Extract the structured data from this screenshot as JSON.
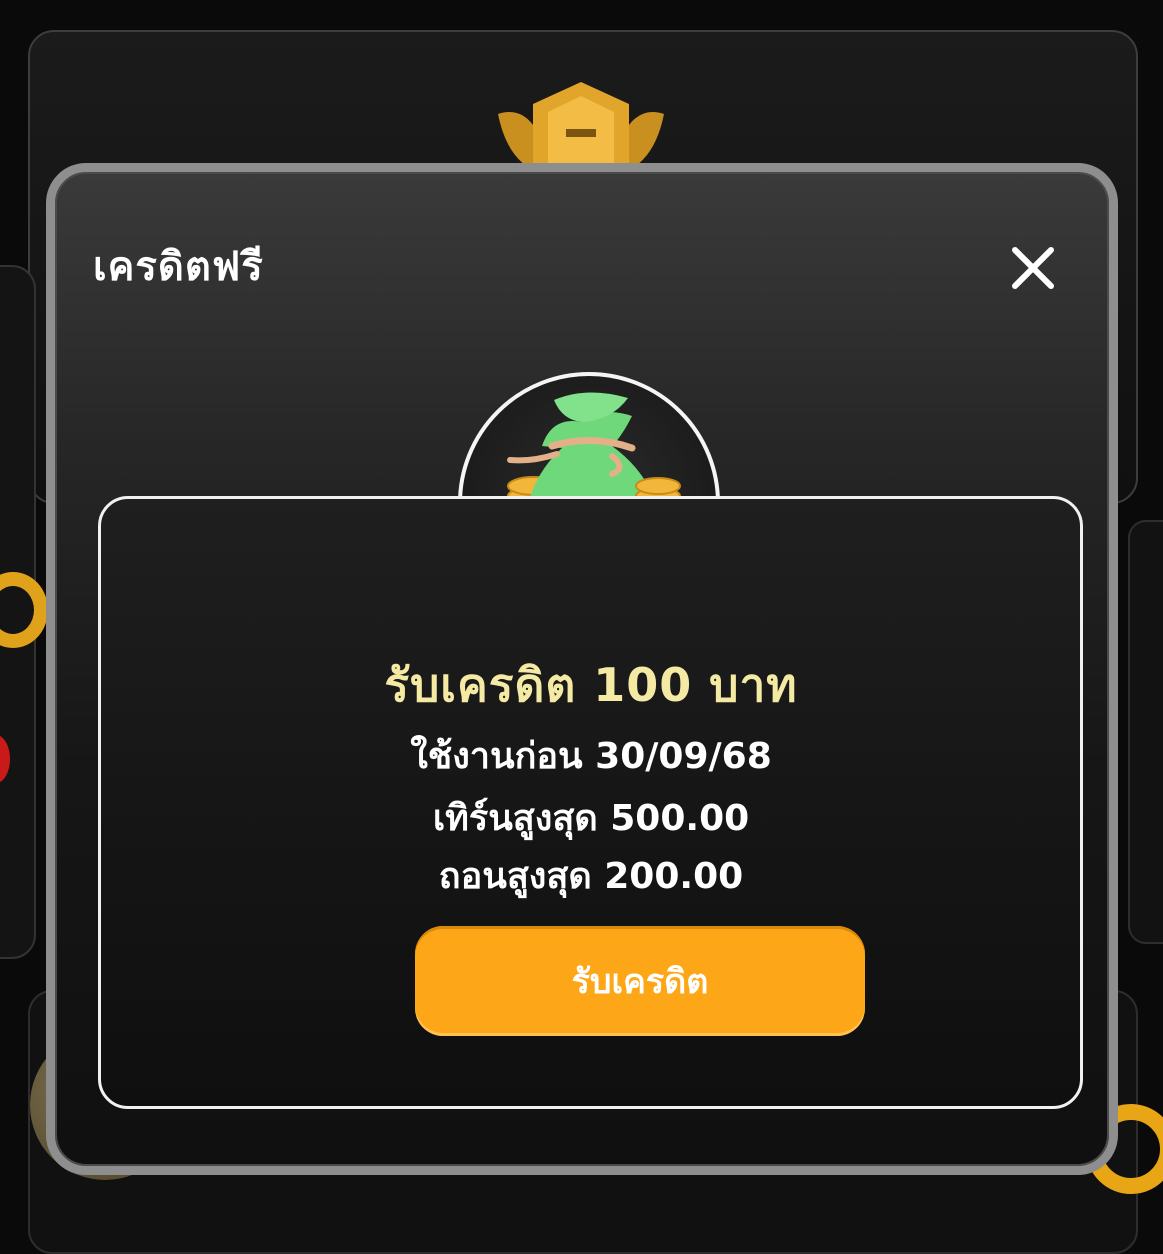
{
  "modal": {
    "title": "เครดิตฟรี",
    "close_icon": "close-icon"
  },
  "reward": {
    "icon": "money-bag-icon",
    "title": "รับเครดิต 100 บาท",
    "expire_text": "ใช้งานก่อน 30/09/68",
    "turnover_text": "เทิร์นสูงสุด 500.00",
    "withdraw_text": "ถอนสูงสุด 200.00"
  },
  "actions": {
    "claim_label": "รับเครดิต"
  },
  "colors": {
    "accent": "#fda718",
    "title_gold": "#f4eaa4",
    "modal_border": "#8e8e8e",
    "panel_border": "#f1f1f1",
    "bag_green": "#6fd87a",
    "coin_gold": "#f2b73a"
  }
}
